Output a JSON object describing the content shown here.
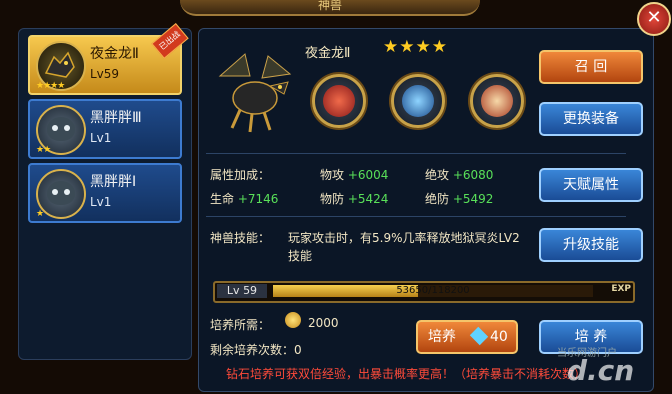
{
  "window": {
    "title": "神兽"
  },
  "pets": [
    {
      "name": "夜金龙Ⅱ",
      "level": "Lv59",
      "stars": "★★★★",
      "badge": "已出战"
    },
    {
      "name": "黑胖胖Ⅲ",
      "level": "Lv1",
      "stars": "★★"
    },
    {
      "name": "黑胖胖Ⅰ",
      "level": "Lv1",
      "stars": "★"
    }
  ],
  "detail": {
    "name": "夜金龙Ⅱ",
    "stars": "★★★★"
  },
  "buttons": {
    "recall": "召 回",
    "change_equipment": "更换装备",
    "talent_attributes": "天赋属性",
    "upgrade_skill": "升级技能",
    "train_gem": "培养",
    "gem_cost": "40",
    "train": "培 养"
  },
  "stats": {
    "bonus_label": "属性加成：",
    "hp": {
      "label": "生命",
      "value": "+7146"
    },
    "patk": {
      "label": "物攻",
      "value": "+6004"
    },
    "pdef": {
      "label": "物防",
      "value": "+5424"
    },
    "abs_atk": {
      "label": "绝攻",
      "value": "+6080"
    },
    "abs_def": {
      "label": "绝防",
      "value": "+5492"
    }
  },
  "skill": {
    "label": "神兽技能：",
    "description": "玩家攻击时，有5.9%几率释放地狱冥炎LV2技能"
  },
  "exp": {
    "lv_prefix": "Lv",
    "level": "59",
    "current": 53650,
    "max": 118200,
    "text": "53650/118200",
    "tag": "EXP"
  },
  "training": {
    "cost_label": "培养所需：",
    "cost_value": "2000",
    "remaining_label": "剩余培养次数：0",
    "tip": "钻石培养可获双倍经验，出暴击概率更高！（培养暴击不消耗次数）"
  },
  "watermark": {
    "text": "当乐网游门户",
    "site": "d.cn"
  }
}
